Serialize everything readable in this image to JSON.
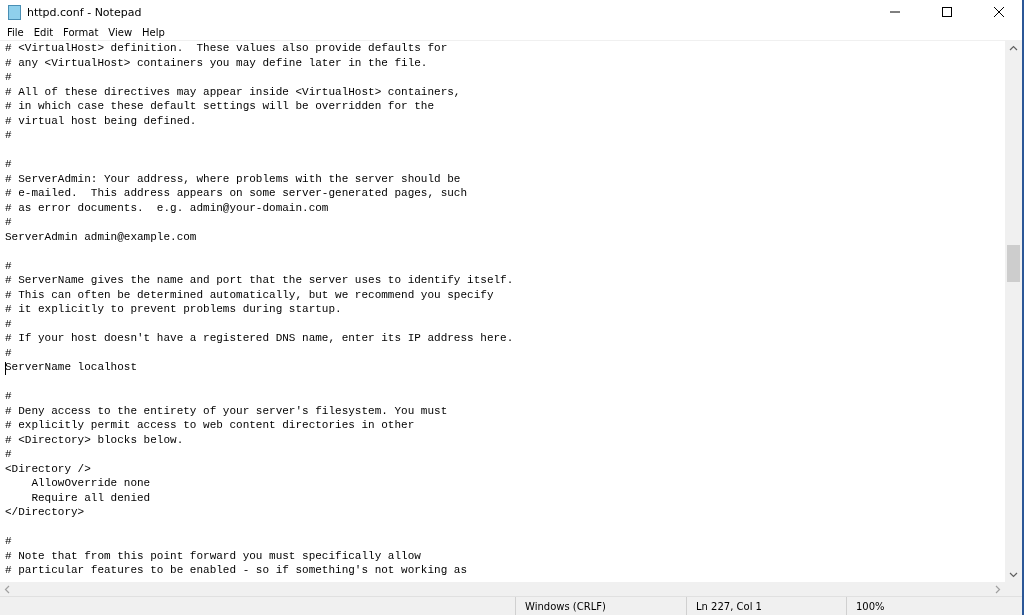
{
  "window": {
    "title": "httpd.conf - Notepad"
  },
  "menu": [
    "File",
    "Edit",
    "Format",
    "View",
    "Help"
  ],
  "editor": {
    "blocks": [
      {
        "lines": [
          {
            "text": "# <VirtualHost> definition.  These values also provide defaults for",
            "caret": false
          },
          {
            "text": "# any <VirtualHost> containers you may define later in the file.",
            "caret": false
          },
          {
            "text": "#",
            "caret": false
          },
          {
            "text": "# All of these directives may appear inside <VirtualHost> containers,",
            "caret": false
          },
          {
            "text": "# in which case these default settings will be overridden for the",
            "caret": false
          },
          {
            "text": "# virtual host being defined.",
            "caret": false
          },
          {
            "text": "#",
            "caret": false
          }
        ]
      },
      {
        "lines": [
          {
            "text": "#",
            "caret": false
          },
          {
            "text": "# ServerAdmin: Your address, where problems with the server should be",
            "caret": false
          },
          {
            "text": "# e-mailed.  This address appears on some server-generated pages, such",
            "caret": false
          },
          {
            "text": "# as error documents.  e.g. admin@your-domain.com",
            "caret": false
          },
          {
            "text": "#",
            "caret": false
          },
          {
            "text": "ServerAdmin admin@example.com",
            "caret": false
          }
        ]
      },
      {
        "lines": [
          {
            "text": "#",
            "caret": false
          },
          {
            "text": "# ServerName gives the name and port that the server uses to identify itself.",
            "caret": false
          },
          {
            "text": "# This can often be determined automatically, but we recommend you specify",
            "caret": false
          },
          {
            "text": "# it explicitly to prevent problems during startup.",
            "caret": false
          },
          {
            "text": "#",
            "caret": false
          },
          {
            "text": "# If your host doesn't have a registered DNS name, enter its IP address here.",
            "caret": false
          },
          {
            "text": "#",
            "caret": false
          },
          {
            "text": "ServerName localhost",
            "caret": true
          }
        ]
      },
      {
        "lines": [
          {
            "text": "#",
            "caret": false
          },
          {
            "text": "# Deny access to the entirety of your server's filesystem. You must",
            "caret": false
          },
          {
            "text": "# explicitly permit access to web content directories in other",
            "caret": false
          },
          {
            "text": "# <Directory> blocks below.",
            "caret": false
          },
          {
            "text": "#",
            "caret": false
          },
          {
            "text": "<Directory />",
            "caret": false
          },
          {
            "text": "    AllowOverride none",
            "caret": false
          },
          {
            "text": "    Require all denied",
            "caret": false
          },
          {
            "text": "</Directory>",
            "caret": false
          }
        ]
      },
      {
        "lines": [
          {
            "text": "#",
            "caret": false
          },
          {
            "text": "# Note that from this point forward you must specifically allow",
            "caret": false
          },
          {
            "text": "# particular features to be enabled - so if something's not working as",
            "caret": false
          }
        ]
      }
    ]
  },
  "status_bar": [
    "Windows (CRLF)",
    "Ln 227, Col 1",
    "100%"
  ]
}
